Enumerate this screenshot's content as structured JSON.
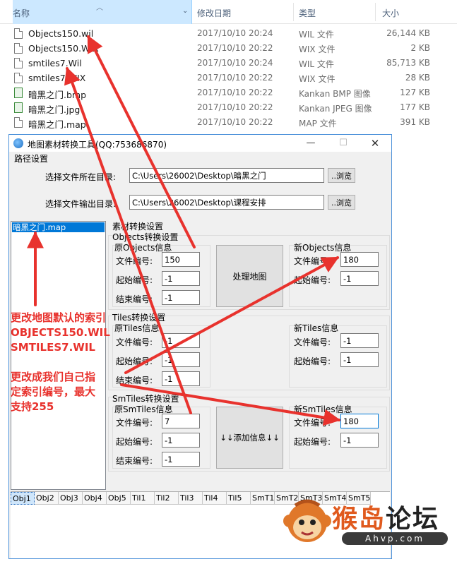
{
  "explorer": {
    "columns": {
      "name": "名称",
      "date": "修改日期",
      "type": "类型",
      "size": "大小"
    },
    "files": [
      {
        "name": "Objects150.wil",
        "date": "2017/10/10 20:24",
        "type": "WIL 文件",
        "size": "26,144 KB",
        "icon": "file-icon"
      },
      {
        "name": "Objects150.WIX",
        "date": "2017/10/10 20:22",
        "type": "WIX 文件",
        "size": "2 KB",
        "icon": "file-icon"
      },
      {
        "name": "smtiles7.Wil",
        "date": "2017/10/10 20:24",
        "type": "WIL 文件",
        "size": "85,713 KB",
        "icon": "file-icon"
      },
      {
        "name": "smtiles7.WIX",
        "date": "2017/10/10 20:22",
        "type": "WIX 文件",
        "size": "28 KB",
        "icon": "file-icon"
      },
      {
        "name": "暗黑之门.bmp",
        "date": "2017/10/10 20:22",
        "type": "Kankan BMP 图像",
        "size": "127 KB",
        "icon": "image-icon"
      },
      {
        "name": "暗黑之门.jpg",
        "date": "2017/10/10 20:22",
        "type": "Kankan JPEG 图像",
        "size": "177 KB",
        "icon": "image-icon"
      },
      {
        "name": "暗黑之门.map",
        "date": "2017/10/10 20:22",
        "type": "MAP 文件",
        "size": "391 KB",
        "icon": "file-icon"
      }
    ]
  },
  "window": {
    "title": "地图素材转换工具(QQ:753686870)",
    "path_group": "路径设置",
    "src_label": "选择文件所在目录:",
    "src_value": "C:\\Users\\26002\\Desktop\\暗黑之门",
    "out_label": "选择文件输出目录:",
    "out_value": "C:\\Users\\26002\\Desktop\\课程安排",
    "browse": "..浏览",
    "list_selected": "暗黑之门.map",
    "material_group": "素材转换设置",
    "objects": {
      "title": "Objects转换设置",
      "orig_title": "原Objects信息",
      "new_title": "新Objects信息",
      "file_no": "150",
      "start": "-1",
      "end": "-1",
      "new_file_no": "180",
      "new_start": "-1"
    },
    "tiles": {
      "title": "Tiles转换设置",
      "orig_title": "原Tiles信息",
      "new_title": "新Tiles信息",
      "file_no": "-1",
      "start": "-1",
      "end": "-1",
      "new_file_no": "-1",
      "new_start": "-1"
    },
    "smtiles": {
      "title": "SmTiles转换设置",
      "orig_title": "原SmTiles信息",
      "new_title": "新SmTiles信息",
      "file_no": "7",
      "start": "-1",
      "end": "-1",
      "new_file_no": "180",
      "new_start": "-1"
    },
    "labels": {
      "file_no": "文件编号:",
      "start": "起始编号:",
      "end": "结束编号:"
    },
    "process_btn": "处理地图",
    "add_btn": "↓↓添加信息↓↓",
    "tabs": [
      "Obj1",
      "Obj2",
      "Obj3",
      "Obj4",
      "Obj5",
      "Til1",
      "Til2",
      "Til3",
      "Til4",
      "Til5",
      "SmT1",
      "SmT2",
      "SmT3",
      "SmT4",
      "SmT5"
    ]
  },
  "annotation": {
    "lines": [
      "更改地图默认的索引",
      "OBJECTS150.WIL",
      "SMTILES7.WIL",
      "",
      "更改成我们自己指",
      "定索引编号，最大",
      "支持255"
    ],
    "color": "#e8322d"
  },
  "watermark": {
    "text_a": "猴岛",
    "text_b": "论坛",
    "url": "Ahvp.com"
  }
}
